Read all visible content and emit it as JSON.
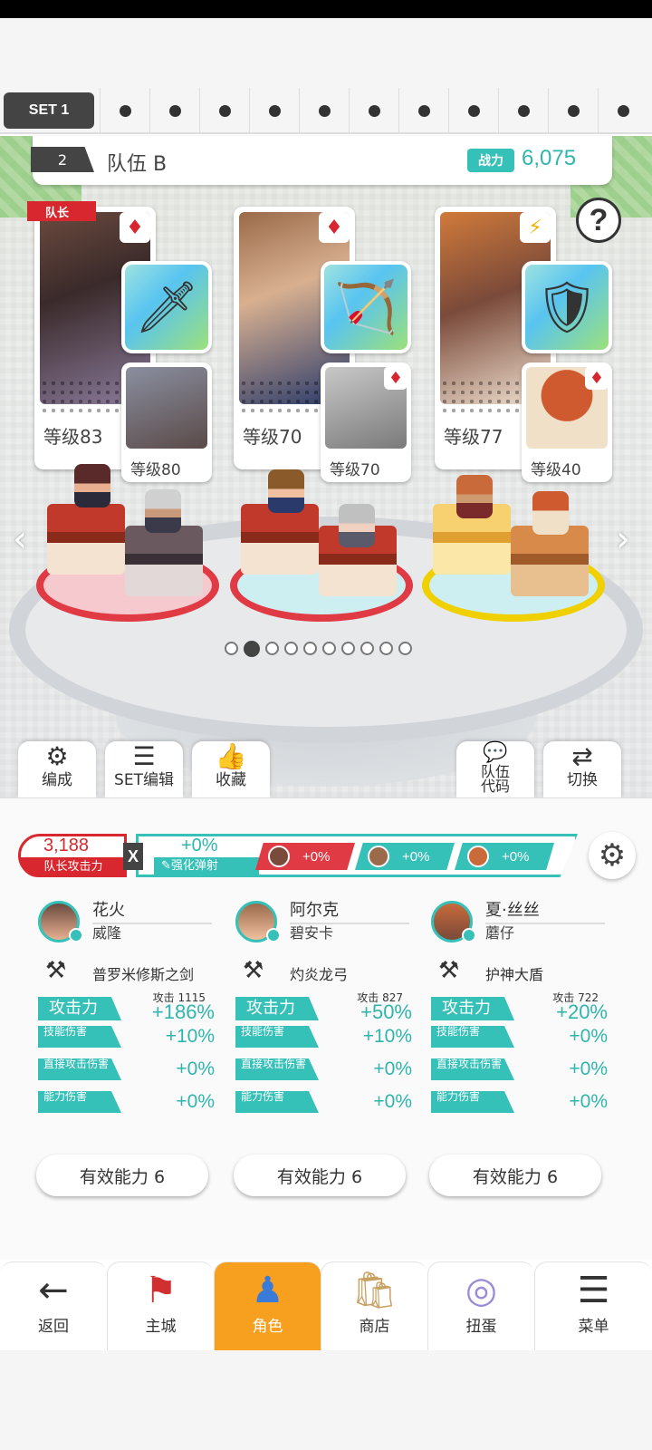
{
  "set_tabs": {
    "active_label": "SET 1",
    "dot_count": 11
  },
  "team": {
    "number": "2",
    "name": "队伍 B",
    "power_label": "战力",
    "power_value": "6,075"
  },
  "help_label": "?",
  "leader_label": "队长",
  "characters": [
    {
      "main_level": "等级83",
      "main_suit": "♦",
      "sub_level": "等级80",
      "weapon_icon": "sword-icon"
    },
    {
      "main_level": "等级70",
      "main_suit": "♦",
      "sub_level": "等级70",
      "weapon_icon": "bow-icon"
    },
    {
      "main_level": "等级77",
      "main_suit": "⚡",
      "sub_level": "等级40",
      "weapon_icon": "shield-icon"
    }
  ],
  "actions": {
    "formation": "编成",
    "set_edit": "SET编辑",
    "favorites": "收藏",
    "team_code_line1": "队伍",
    "team_code_line2": "代码",
    "switch": "切换"
  },
  "attack": {
    "total_value": "3,188",
    "total_label": "队长攻击力",
    "multiplier": "X",
    "bonus_value": "+0%",
    "bonus_label": "强化弹射",
    "char_bonuses": [
      "+0%",
      "+0%",
      "+0%"
    ]
  },
  "columns": [
    {
      "name": "花火",
      "sub": "威隆",
      "weapon": "普罗米修斯之剑",
      "atk_label": "攻击力",
      "atk_small": "攻击  1115",
      "atk_pct": "+186%",
      "skill_label": "技能伤害",
      "skill_pct": "+10%",
      "direct_label": "直接攻击伤害",
      "direct_pct": "+0%",
      "ability_label": "能力伤害",
      "ability_pct": "+0%",
      "effective": "有效能力 6"
    },
    {
      "name": "阿尔克",
      "sub": "碧安卡",
      "weapon": "灼炎龙弓",
      "atk_label": "攻击力",
      "atk_small": "攻击   827",
      "atk_pct": "+50%",
      "skill_label": "技能伤害",
      "skill_pct": "+10%",
      "direct_label": "直接攻击伤害",
      "direct_pct": "+0%",
      "ability_label": "能力伤害",
      "ability_pct": "+0%",
      "effective": "有效能力 6"
    },
    {
      "name": "夏·丝丝",
      "sub": "蘑仔",
      "weapon": "护神大盾",
      "atk_label": "攻击力",
      "atk_small": "攻击   722",
      "atk_pct": "+20%",
      "skill_label": "技能伤害",
      "skill_pct": "+0%",
      "direct_label": "直接攻击伤害",
      "direct_pct": "+0%",
      "ability_label": "能力伤害",
      "ability_pct": "+0%",
      "effective": "有效能力 6"
    }
  ],
  "nav": {
    "back": "返回",
    "town": "主城",
    "hero": "角色",
    "shop": "商店",
    "gacha": "扭蛋",
    "menu": "菜单"
  },
  "page_dots": {
    "count": 10,
    "active_index": 1
  },
  "colors": {
    "accent": "#35c0b8",
    "leader_red": "#d8272f",
    "nav_active": "#f7a020"
  }
}
